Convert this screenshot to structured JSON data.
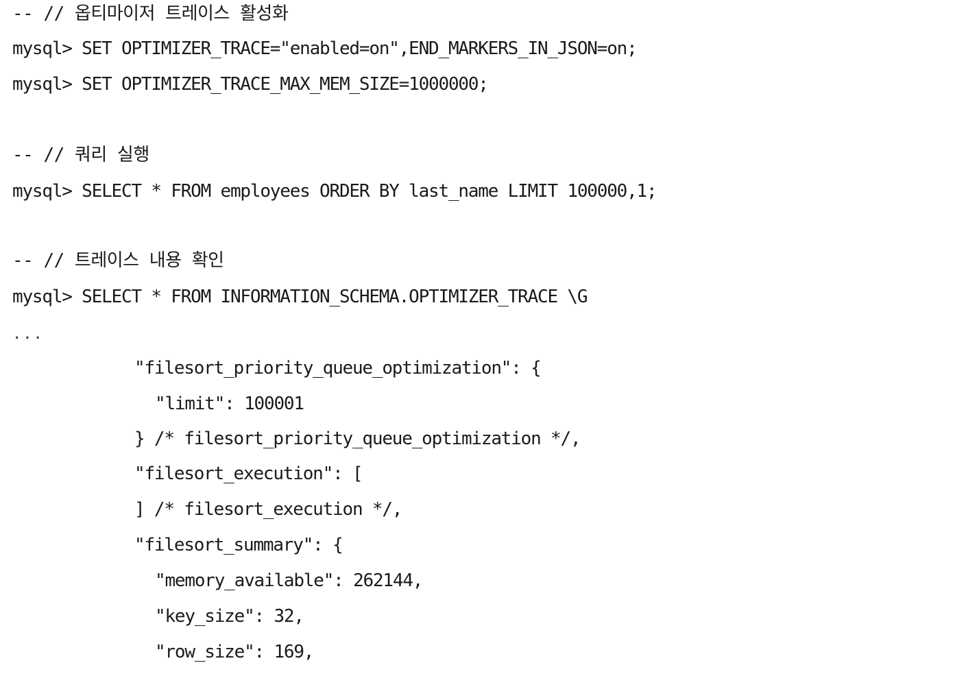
{
  "lines": [
    "-- // 옵티마이저 트레이스 활성화",
    "mysql> SET OPTIMIZER_TRACE=\"enabled=on\",END_MARKERS_IN_JSON=on;",
    "mysql> SET OPTIMIZER_TRACE_MAX_MEM_SIZE=1000000;",
    "-- // 쿼리 실행",
    "mysql> SELECT * FROM employees ORDER BY last_name LIMIT 100000,1;",
    "-- // 트레이스 내용 확인",
    "mysql> SELECT * FROM INFORMATION_SCHEMA.OPTIMIZER_TRACE \\G",
    "...",
    "\"filesort_priority_queue_optimization\": {",
    "\"limit\": 100001",
    "} /* filesort_priority_queue_optimization */,",
    "\"filesort_execution\": [",
    "] /* filesort_execution */,",
    "\"filesort_summary\": {",
    "\"memory_available\": 262144,",
    "\"key_size\": 32,",
    "\"row_size\": 169,"
  ]
}
